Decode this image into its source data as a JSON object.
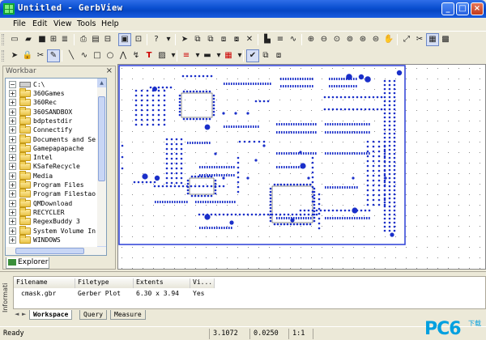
{
  "window": {
    "title": "Untitled - GerbView",
    "controls": [
      "minimize",
      "maximize",
      "close"
    ]
  },
  "menu": [
    {
      "label": "File",
      "key": "F"
    },
    {
      "label": "Edit",
      "key": "E"
    },
    {
      "label": "View",
      "key": "V"
    },
    {
      "label": "Tools",
      "key": "T"
    },
    {
      "label": "Help",
      "key": "H"
    }
  ],
  "toolbar1": {
    "icons": [
      "new-icon",
      "open-icon",
      "save-icon",
      "print-setup-icon",
      "print-icon",
      "print-preview-icon",
      "layout-icon",
      "layers-icon",
      "help-icon",
      "select-icon",
      "copy-icon",
      "paste-icon",
      "group-icon",
      "delete-icon",
      "fill-icon",
      "line-style-icon",
      "move-icon",
      "zoom-in-icon",
      "zoom-out-icon",
      "zoom-window-icon",
      "zoom-fit-icon",
      "zoom-prev-icon",
      "zoom-all-icon",
      "zoom-select-icon",
      "pan-icon",
      "measure-icon",
      "snap-icon",
      "grid-icon",
      "grid-snap-icon"
    ]
  },
  "toolbar2": {
    "icons": [
      "cursor-icon",
      "lock-icon",
      "scissors-icon",
      "edit-icon",
      "line-icon",
      "arc-icon",
      "rect-icon",
      "circle-icon",
      "polyline-icon",
      "curve-icon",
      "text-icon",
      "image-icon",
      "line-color-icon",
      "fill-color-icon",
      "brush-icon",
      "check-icon",
      "duplicate-icon",
      "stack-icon"
    ]
  },
  "workbar": {
    "title": "Workbar",
    "root": "C:\\",
    "items": [
      "360Games",
      "360Rec",
      "360SANDBOX",
      "bdptestdir",
      "Connectify",
      "Documents and Se",
      "Gamepapapache",
      "Intel",
      "KSafeRecycle",
      "Media",
      "Program Files",
      "Program Filestao",
      "QMDownload",
      "RECYCLER",
      "RegexBuddy 3",
      "System Volume In",
      "WINDOWS"
    ],
    "tab": "Explorer"
  },
  "info": {
    "side_label": "Informati",
    "columns": [
      "Filename",
      "Filetype",
      "Extents",
      "Vi..."
    ],
    "rows": [
      [
        "cmask.gbr",
        "Gerber Plot",
        "6.30 x 3.94",
        "Yes"
      ]
    ],
    "tabs": [
      "Workspace",
      "Query",
      "Measure"
    ],
    "active_tab": "Workspace"
  },
  "status": {
    "message": "Ready",
    "x": "3.1072",
    "y": "0.0250",
    "zoom": "1:1"
  },
  "watermark": {
    "text": "PC6",
    "small": "下载"
  },
  "colors": {
    "accent": "#2b3fd6",
    "pads": "#1a2fc9",
    "title": "#0a4fd0"
  }
}
